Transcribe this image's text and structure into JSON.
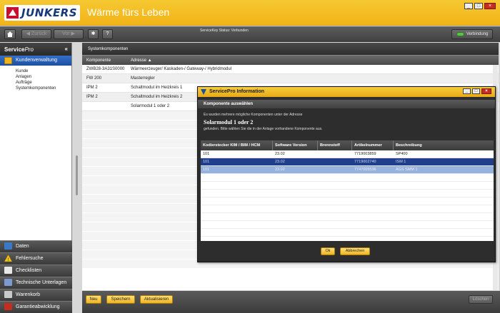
{
  "header": {
    "brand": "JUNKERS",
    "slogan": "Wärme fürs Leben"
  },
  "window_controls": {
    "minimize": "_",
    "maximize": "□",
    "close": "×"
  },
  "toolbar": {
    "back_label": "Zurück",
    "forward_label": "Vor",
    "status": "ServiceKey Status: Verbunden",
    "connection_label": "Verbindung",
    "connection_color": "#59c24a"
  },
  "sidebar": {
    "brand_prefix": "Service",
    "brand_suffix": "Pro",
    "collapse": "«",
    "active_item": "Kundenverwaltung",
    "sub_items": [
      "Kunde",
      "Anlagen",
      "Aufträge",
      "Systemkomponenten"
    ],
    "nav_items": [
      "Daten",
      "Fehlersuche",
      "Checklisten",
      "Technische Unterlagen",
      "Warenkorb",
      "Garantieabwicklung"
    ]
  },
  "main": {
    "title": "Systemkomponenten",
    "columns": [
      "Komponente",
      "Adresse ▲"
    ],
    "rows": [
      {
        "komponente": "ZWB28-3A31S0000",
        "adresse": "Wärmeerzeuger/ Kaskaden-/ Gateway-/ Hybridmodul"
      },
      {
        "komponente": "FW 200",
        "adresse": "Masterregler"
      },
      {
        "komponente": "IPM 2",
        "adresse": "Schaltmodul im Heizkreis 1"
      },
      {
        "komponente": "IPM 2",
        "adresse": "Schaltmodul im Heizkreis 2"
      },
      {
        "komponente": "",
        "adresse": "Solarmodul 1 oder 2"
      }
    ]
  },
  "actions": {
    "neu": "Neu",
    "speichern": "Speichern",
    "aktualisieren": "Aktualisieren",
    "loeschen": "Löschen"
  },
  "dialog": {
    "title": "ServicePro Information",
    "subtitle": "Komponente auswählen",
    "info_line1": "Es wurden mehrere mögliche Komponenten unter der Adresse",
    "address": "Solarmodul 1 oder 2",
    "info_line2": "gefunden. Bitte wählen Sie die in der Anlage vorhandene Komponente aus.",
    "columns": [
      "Kodierstecker KIM / BIM / HCM",
      "Software Version",
      "Brennstoff",
      "Artikelnummer",
      "Beschreibung"
    ],
    "rows": [
      {
        "kodierstecker": "101",
        "software": "23.02",
        "brennstoff": "",
        "artikel": "7719003859",
        "beschreibung": "SP400"
      },
      {
        "kodierstecker": "101",
        "software": "23.02",
        "brennstoff": "",
        "artikel": "7719002740",
        "beschreibung": "ISM 1"
      },
      {
        "kodierstecker": "101",
        "software": "23.02",
        "brennstoff": "",
        "artikel": "7747005536",
        "beschreibung": "AGS SMM 1"
      }
    ],
    "ok_label": "Ok",
    "cancel_label": "Abbrechen"
  }
}
